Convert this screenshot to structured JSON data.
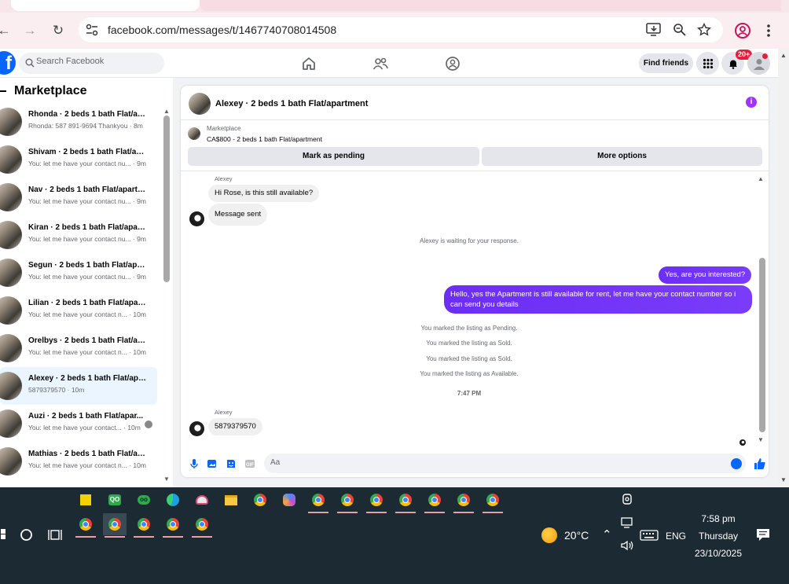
{
  "browser": {
    "url": "facebook.com/messages/t/1467740708014508"
  },
  "facebook": {
    "search_placeholder": "Search Facebook",
    "find_friends_label": "Find friends",
    "notification_count": "20+"
  },
  "marketplace": {
    "title": "Marketplace",
    "conversations": [
      {
        "name": "Rhonda · 2 beds 1 bath Flat/ap...",
        "preview": "Rhonda: 587 891-9694 Thankyou · 8m",
        "active": false
      },
      {
        "name": "Shivam · 2 beds 1 bath Flat/apa...",
        "preview": "You: let me have your contact nu... · 9m",
        "active": false
      },
      {
        "name": "Nav · 2 beds 1 bath Flat/apartm...",
        "preview": "You: let me have your contact nu... · 9m",
        "active": false
      },
      {
        "name": "Kiran · 2 beds 1 bath Flat/apart...",
        "preview": "You: let me have your contact nu... · 9m",
        "active": false
      },
      {
        "name": "Segun · 2 beds 1 bath Flat/apar...",
        "preview": "You: let me have your contact nu... · 9m",
        "active": false
      },
      {
        "name": "Lilian · 2 beds 1 bath Flat/apart...",
        "preview": "You: let me have your contact n... · 10m",
        "active": false
      },
      {
        "name": "Orelbys · 2 beds 1 bath Flat/apa...",
        "preview": "You: let me have your contact n... · 10m",
        "active": false
      },
      {
        "name": "Alexey · 2 beds 1 bath Flat/apar...",
        "preview": "5879379570 · 10m",
        "active": true
      },
      {
        "name": "Auzi · 2 beds 1 bath Flat/apar...",
        "preview": "You: let me have your contact... · 10m",
        "active": false
      },
      {
        "name": "Mathias · 2 beds 1 bath Flat/ap...",
        "preview": "You: let me have your contact n... · 10m",
        "active": false
      }
    ]
  },
  "chat": {
    "title": "Alexey · 2 beds 1 bath Flat/apartment",
    "listing_label": "Marketplace",
    "listing_item": "CA$800 - 2 beds 1 bath Flat/apartment",
    "mark_pending_label": "Mark as pending",
    "more_options_label": "More options",
    "sender_name_1": "Alexey",
    "msg_in_1": "Hi Rose, is this still available?",
    "msg_in_2": "Message sent",
    "waiting_text": "Alexey is waiting for your response.",
    "msg_out_1": "Yes, are you interested?",
    "msg_out_2": "Hello, yes the Apartment is still available for rent, let me have your contact number so i can send you details",
    "sys_1": "You marked the listing as Pending.",
    "sys_2": "You marked the listing as Sold.",
    "sys_3": "You marked the listing as Sold.",
    "sys_4": "You marked the listing as Available.",
    "timestamp": "7:47 PM",
    "sender_name_2": "Alexey",
    "msg_in_3": "5879379570",
    "composer_placeholder": "Aa"
  },
  "taskbar": {
    "temperature": "20°C",
    "language": "ENG",
    "time": "7:58 pm",
    "day": "Thursday",
    "date": "23/10/2025"
  },
  "colors": {
    "facebook_blue": "#0866ff",
    "outgoing_bubble": "#7a3cfa",
    "taskbar_bg": "#1c2a33"
  }
}
